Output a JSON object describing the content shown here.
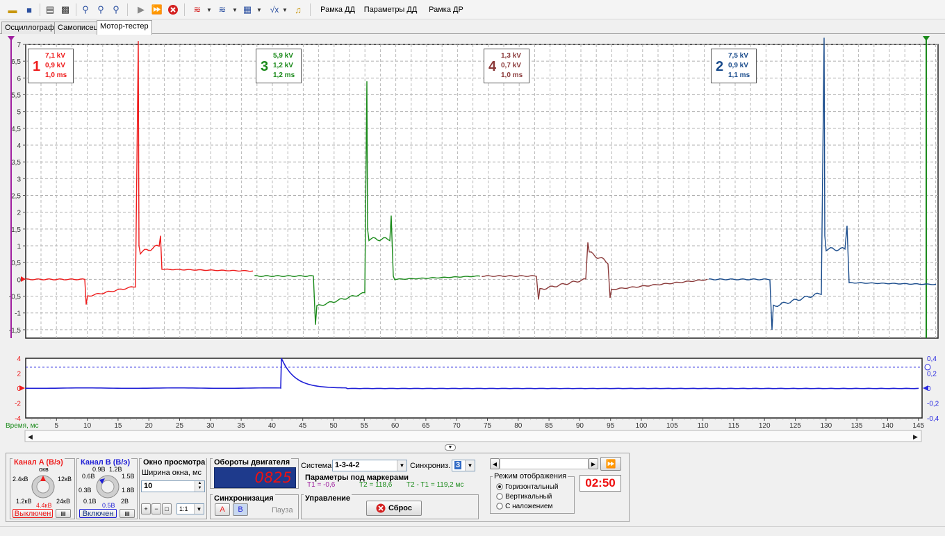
{
  "toolbar": {
    "items": [
      "folder-open-icon",
      "save-icon",
      "print-preview-icon",
      "print-icon",
      "zoom-in-icon",
      "zoom-reset-icon",
      "zoom-out-icon",
      "play-icon",
      "fast-forward-icon",
      "stop-icon",
      "filter-a-icon",
      "filter-b-icon",
      "calculator-icon",
      "sqrt-icon",
      "sound-icon"
    ],
    "frame_dd": "Рамка ДД",
    "params_dd": "Параметры ДД",
    "frame_dr": "Рамка ДР"
  },
  "tabs": [
    "Осциллограф",
    "Самописец",
    "Мотор-тестер"
  ],
  "active_tab": 2,
  "main_plot": {
    "y_ticks": [
      "7",
      "6,5",
      "6",
      "5,5",
      "5",
      "4,5",
      "4",
      "3,5",
      "3",
      "2,5",
      "2",
      "1,5",
      "1",
      "0,5",
      "0",
      "-0,5",
      "-1",
      "-1,5"
    ],
    "markers": [
      {
        "num": "1",
        "kv": "7,1 kV",
        "burn_kv": "0,9 kV",
        "ms": "1,0 ms",
        "color": "#ee1c1c"
      },
      {
        "num": "3",
        "kv": "5,9 kV",
        "burn_kv": "1,2 kV",
        "ms": "1,2 ms",
        "color": "#1a8a1a"
      },
      {
        "num": "4",
        "kv": "1,3 kV",
        "burn_kv": "0,7 kV",
        "ms": "1,0 ms",
        "color": "#8b3a3a"
      },
      {
        "num": "2",
        "kv": "7,5 kV",
        "burn_kv": "0,9 kV",
        "ms": "1,1 ms",
        "color": "#1a4c8c"
      }
    ]
  },
  "lower_plot": {
    "left_ticks": [
      "4",
      "2",
      "0",
      "-2",
      "-4"
    ],
    "right_ticks": [
      "0,4",
      "0,2",
      "0",
      "-0,2",
      "-0,4"
    ],
    "x_axis_label": "Время, мс",
    "x_ticks": [
      "5",
      "10",
      "15",
      "20",
      "25",
      "30",
      "35",
      "40",
      "45",
      "50",
      "55",
      "60",
      "65",
      "70",
      "75",
      "80",
      "85",
      "90",
      "95",
      "100",
      "105",
      "110",
      "115",
      "120",
      "125",
      "130",
      "135",
      "140",
      "145"
    ]
  },
  "channel_a": {
    "title": "Канал A (В/э)",
    "labels": [
      "окв",
      "2.4кВ",
      "12кВ",
      "1.2кВ",
      "24кВ",
      "4.4кВ"
    ],
    "status": "Выключен"
  },
  "channel_b": {
    "title": "Канал B (В/э)",
    "labels": [
      "0.9В",
      "1.2В",
      "0.6В",
      "1.5В",
      "0.3В",
      "1.8В",
      "0.1В",
      "0.5В",
      "2В"
    ],
    "status": "Включен"
  },
  "view_window": {
    "title": "Окно просмотра",
    "width_label": "Ширина окна, мс",
    "width_value": "10",
    "scale": "1:1"
  },
  "rpm": {
    "title": "Обороты двигателя",
    "value": "0825"
  },
  "sync": {
    "title": "Синхронизация",
    "a": "A",
    "b": "B",
    "pause": "Пауза"
  },
  "system": {
    "label": "Система",
    "value": "1-3-4-2",
    "sync_label": "Синхрониз.",
    "sync_value": "3"
  },
  "marker_params": {
    "title": "Параметры под маркерами",
    "t1": "T1 = -0,6",
    "t2": "T2 = 118,6",
    "dt": "T2 - T1 = 119,2 мс"
  },
  "control": {
    "title": "Управление",
    "reset": "Сброс"
  },
  "display_mode": {
    "title": "Режим отображения",
    "options": [
      "Горизонтальный",
      "Вертикальный",
      "С наложением"
    ],
    "selected": 0
  },
  "timer": "02:50",
  "colors": {
    "cyl1": "#ee1c1c",
    "cyl2": "#1a4c8c",
    "cyl3": "#1a8a1a",
    "cyl4": "#8b3a3a",
    "trace_b": "#1f1fd6",
    "rpm_text": "#ee1111",
    "rpm_bg": "#1e3a8c"
  }
}
